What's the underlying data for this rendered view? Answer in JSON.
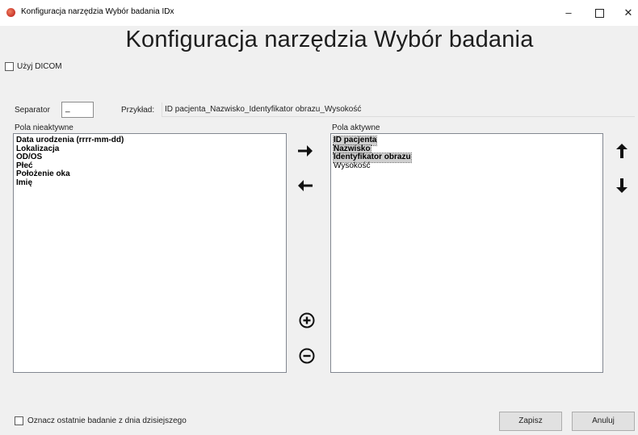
{
  "window": {
    "title": "Konfiguracja narzędzia Wybór badania IDx",
    "minimize": "–",
    "close": "✕"
  },
  "heading": "Konfiguracja narzędzia Wybór badania",
  "use_dicom": {
    "label": "Użyj DICOM",
    "checked": false
  },
  "separator": {
    "label": "Separator",
    "value": "_"
  },
  "example": {
    "label": "Przykład:",
    "value": "ID pacjenta_Nazwisko_Identyfikator obrazu_Wysokość"
  },
  "inactive": {
    "label": "Pola nieaktywne",
    "items": [
      {
        "text": "Data urodzenia (rrrr-mm-dd)",
        "bold": true
      },
      {
        "text": "Lokalizacja",
        "bold": true
      },
      {
        "text": "OD/OS",
        "bold": true
      },
      {
        "text": "Płeć",
        "bold": true
      },
      {
        "text": "Położenie oka",
        "bold": true
      },
      {
        "text": "Imię",
        "bold": true
      }
    ]
  },
  "active": {
    "label": "Pola aktywne",
    "items": [
      {
        "text": "ID pacjenta",
        "bold": true,
        "selected": true
      },
      {
        "text": "Nazwisko",
        "bold": true,
        "selected": true
      },
      {
        "text": "Identyfikator obrazu",
        "bold": true,
        "selected": true
      },
      {
        "text": "Wysokość",
        "bold": false,
        "selected": false
      }
    ]
  },
  "icons": {
    "move_right": "arrow-right-icon",
    "move_left": "arrow-left-icon",
    "move_up": "arrow-up-icon",
    "move_down": "arrow-down-icon",
    "add": "plus-circle-icon",
    "remove": "minus-circle-icon"
  },
  "mark_today": {
    "label": "Oznacz ostatnie badanie z dnia dzisiejszego",
    "checked": false
  },
  "buttons": {
    "save": "Zapisz",
    "cancel": "Anuluj"
  }
}
